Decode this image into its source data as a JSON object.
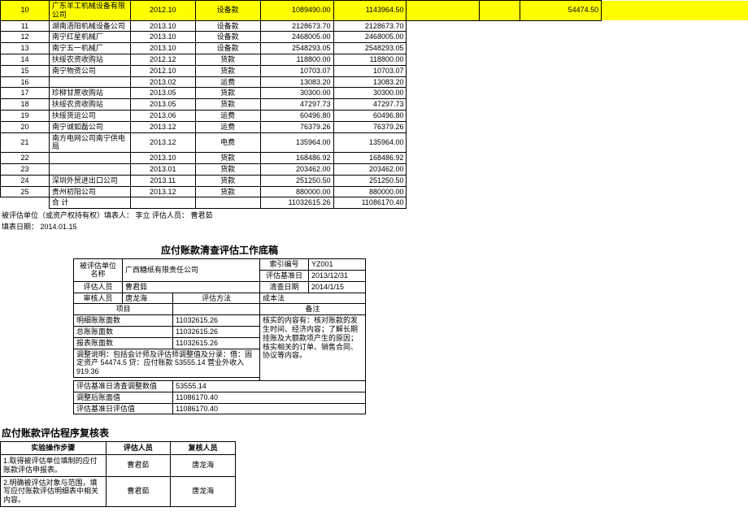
{
  "table1": {
    "rows": [
      {
        "idx": "10",
        "name": "广东羊工机械设备有限公司",
        "date": "2012.10",
        "type": "设备款",
        "amt1": "1089490.00",
        "amt2": "1143964.50",
        "extra3": "54474.50",
        "hl": true
      },
      {
        "idx": "11",
        "name": "湖南浯阳机械设备公司",
        "date": "2013.10",
        "type": "设备款",
        "amt1": "2128673.70",
        "amt2": "2128673.70"
      },
      {
        "idx": "12",
        "name": "南宁红星机械厂",
        "date": "2013.10",
        "type": "设备款",
        "amt1": "2468005.00",
        "amt2": "2468005.00"
      },
      {
        "idx": "13",
        "name": "南宁五一机械厂",
        "date": "2013.10",
        "type": "设备款",
        "amt1": "2548293.05",
        "amt2": "2548293.05"
      },
      {
        "idx": "14",
        "name": "扶绥农资收购站",
        "date": "2012.12",
        "type": "货款",
        "amt1": "118800.00",
        "amt2": "118800.00"
      },
      {
        "idx": "15",
        "name": "南宁物资公司",
        "date": "2012.10",
        "type": "货款",
        "amt1": "10703.07",
        "amt2": "10703.07"
      },
      {
        "idx": "16",
        "name": "",
        "date": "2013.02",
        "type": "运费",
        "amt1": "13083.20",
        "amt2": "13083.20"
      },
      {
        "idx": "17",
        "name": "珍柳甘蔗收购站",
        "date": "2013.05",
        "type": "货款",
        "amt1": "30300.00",
        "amt2": "30300.00"
      },
      {
        "idx": "18",
        "name": "扶绥农资收购站",
        "date": "2013.05",
        "type": "货款",
        "amt1": "47297.73",
        "amt2": "47297.73"
      },
      {
        "idx": "19",
        "name": "扶绥货运公司",
        "date": "2013.06",
        "type": "运费",
        "amt1": "60496.80",
        "amt2": "60496.80"
      },
      {
        "idx": "20",
        "name": "南宁诚如磊公司",
        "date": "2013.12",
        "type": "运费",
        "amt1": "76379.26",
        "amt2": "76379.26"
      },
      {
        "idx": "21",
        "name": "南方电网公司南宁供电局",
        "date": "2013.12",
        "type": "电费",
        "amt1": "135964.00",
        "amt2": "135964.00"
      },
      {
        "idx": "22",
        "name": "",
        "date": "2013.10",
        "type": "货款",
        "amt1": "168486.92",
        "amt2": "168486.92"
      },
      {
        "idx": "23",
        "name": "",
        "date": "2013.01",
        "type": "货款",
        "amt1": "203462.00",
        "amt2": "203462.00"
      },
      {
        "idx": "24",
        "name": "深圳外贸进出口公司",
        "date": "2013.11",
        "type": "货款",
        "amt1": "251250.50",
        "amt2": "251250.50"
      },
      {
        "idx": "25",
        "name": "贵州初阳公司",
        "date": "2013.12",
        "type": "货款",
        "amt1": "880000.00",
        "amt2": "880000.00"
      }
    ],
    "total_row": {
      "label": "合  计",
      "amt1": "11032615.26",
      "amt2": "11086170.40"
    },
    "footer1": "被评估单位（或资产权持有权）填表人：  李立                          评估人员：                                  曹君茹",
    "footer2": "填表日期：  2014.01.15"
  },
  "section2": {
    "title": "应付账款清查评估工作底稿",
    "r1a": "被评估单位名称",
    "r1b": "广西糖纸有限责任公司",
    "r1c": "索引编号",
    "r1d": "YZ001",
    "r2c": "评估基准日",
    "r2d": "2013/12/31",
    "r3a": "评估人员",
    "r3b": "曹君茹",
    "r3c": "清查日期",
    "r3d": "2014/1/15",
    "r4a": "审核人员",
    "r4b": "唐龙海",
    "r4c": "评估方法",
    "r4d": "成本法",
    "hdr_item": "项目",
    "hdr_note": "备注",
    "it1": "明细账账面数",
    "v1": "11032615.26",
    "it2": "总账账面数",
    "v2": "11032615.26",
    "it3": "报表账面数",
    "v3": "11032615.26",
    "it4": "调整说明：包括会计师及评估师调整值及分录：借：固定资产 54474.5 贷：应付账款 53555.14 营业外收入 919.36",
    "note": "核实的内容有：核对账款的发生时间、经济内容；了解长期挂账及大额款项产生的原因；核实相关的订单、销售合同、协议等内容。",
    "it5": "评估基准日清查调整数值",
    "v5": "53555.14",
    "it6": "调整后账面值",
    "v6": "11086170.40",
    "it7": "评估基准日评估值",
    "v7": "11086170.40"
  },
  "section3": {
    "title": "应付账款评估程序复核表",
    "h1": "实验操作步骤",
    "h2": "评估人员",
    "h3": "复核人员",
    "s1": "1.取得被评估单位填制的应付账款评估申报表。",
    "p1": "曹君茹",
    "c1": "唐龙海",
    "s2": "2.明确被评估对象与范围，填写应付账款评估明细表中相关内容。",
    "p2": "曹君茹",
    "c2": "唐龙海"
  }
}
